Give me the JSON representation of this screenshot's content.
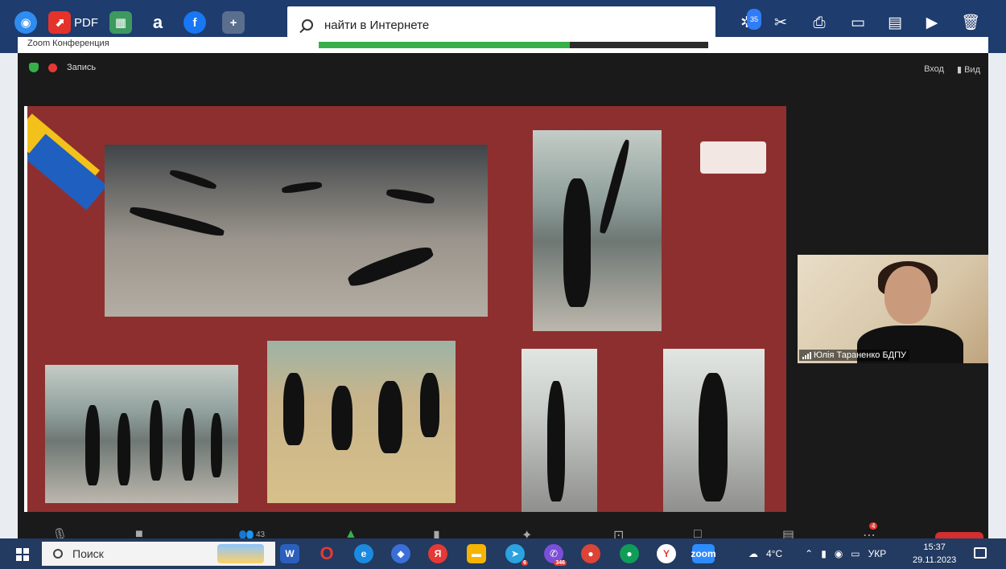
{
  "topbar": {
    "pdf_label": "PDF",
    "search_placeholder": "найти в Интернете",
    "badge_count": "35"
  },
  "zoom": {
    "window_title": "Zoom Конференция",
    "recording_label": "Запись",
    "enter_label": "Вход",
    "view_label": "Вид",
    "participants_count": "43",
    "more_badge": "4"
  },
  "participant": {
    "name": "Юлія Тараненко БДПУ"
  },
  "taskbar": {
    "search_label": "Поиск",
    "weather": "4°C",
    "language": "УКР",
    "time": "15:37",
    "date": "29.11.2023",
    "telegram_badge": "6",
    "viber_badge": "346"
  },
  "colors": {
    "slide_bg": "#8e2f2f",
    "topbar_bg": "#1e3c6e",
    "taskbar_bg": "#233a61"
  }
}
